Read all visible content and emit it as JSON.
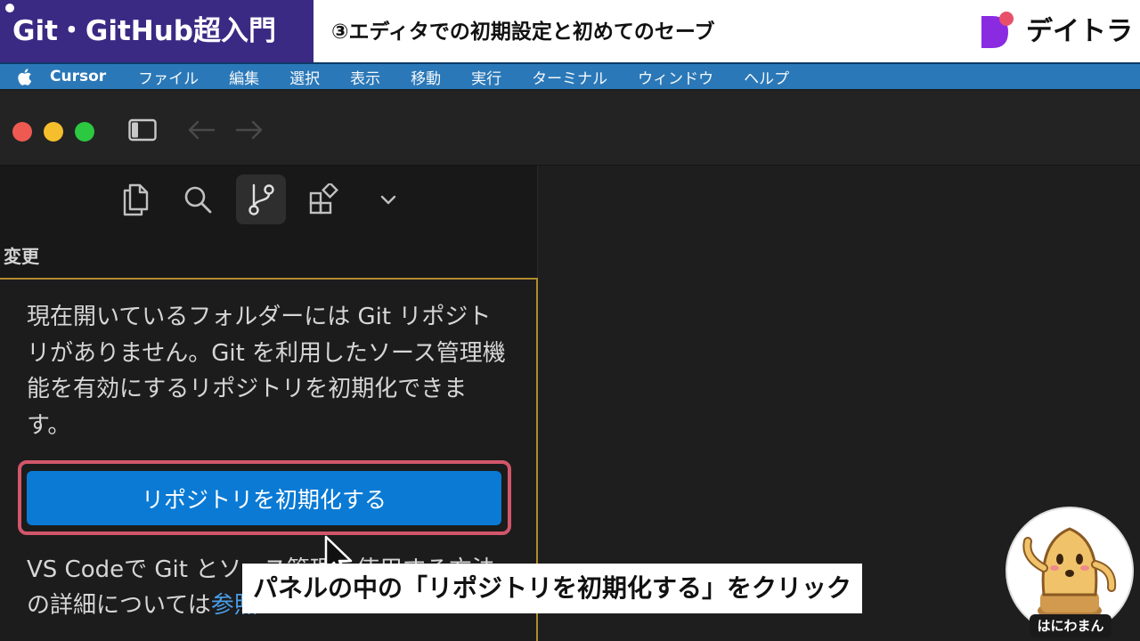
{
  "banner": {
    "series_title": "Git・GitHub超入門",
    "episode_title": "③エディタでの初期設定と初めてのセーブ",
    "brand": "デイトラ",
    "colors": {
      "series_bg": "#3a2a84",
      "logo_purple": "#8a2be2",
      "logo_pink": "#e8506a"
    }
  },
  "menubar": {
    "apple_icon": "apple-icon",
    "app": "Cursor",
    "items": [
      "ファイル",
      "編集",
      "選択",
      "表示",
      "移動",
      "実行",
      "ターミナル",
      "ウィンドウ",
      "ヘルプ"
    ]
  },
  "window": {
    "icons": [
      "close-icon",
      "minimize-icon",
      "zoom-icon",
      "sidebar-toggle-icon",
      "arrow-left-icon",
      "arrow-right-icon"
    ]
  },
  "activity_bar": {
    "icons": [
      "explorer-icon",
      "search-icon",
      "source-control-icon",
      "extensions-icon",
      "chevron-down-icon"
    ],
    "active": "source-control-icon"
  },
  "source_control": {
    "section_title": "変更",
    "message": "現在開いているフォルダーには Git リポジトリがありません。Git を利用したソース管理機能を有効にするリポジトリを初期化できます。",
    "button_label": "リポジトリを初期化する",
    "footer_text": "VS Codeで Git とソース管理を使用する方法の詳細については",
    "footer_link": "参照",
    "colors": {
      "button": "#0a7ad4",
      "highlight": "#d2566a",
      "panel_border": "#b08a2e"
    }
  },
  "caption": {
    "text": "パネルの中の「リポジトリを初期化する」をクリック"
  },
  "mascot": {
    "label": "はにわまん"
  }
}
